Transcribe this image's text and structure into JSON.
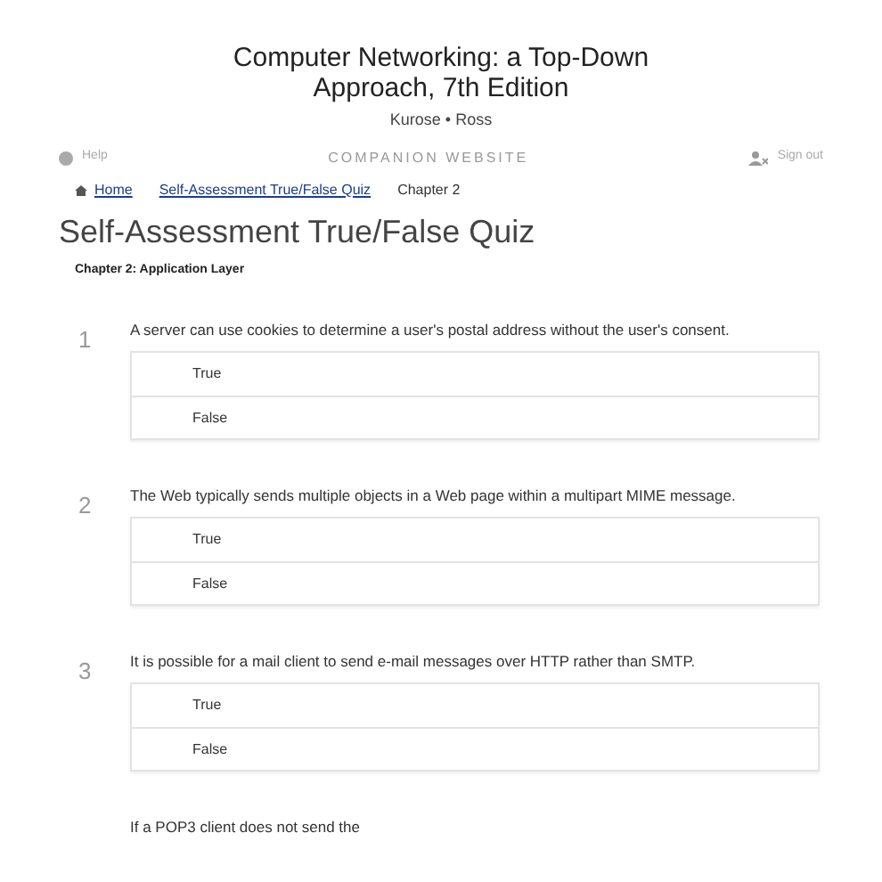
{
  "header": {
    "title": "Computer Networking: a Top-Down Approach, 7th Edition",
    "authors": "Kurose • Ross"
  },
  "nav": {
    "help": "Help",
    "site": "COMPANION WEBSITE",
    "sign_out": "Sign out"
  },
  "breadcrumb": [
    {
      "label": "Home",
      "kind": "link"
    },
    {
      "label": "Self-Assessment True/False Quiz",
      "kind": "link"
    },
    {
      "label": "Chapter 2",
      "kind": "current"
    }
  ],
  "heading": "Self-Assessment True/False Quiz",
  "subheading": "Chapter 2: Application Layer",
  "questions": [
    {
      "number": "1",
      "text": "A server can use cookies to determine a user's postal address without the user's consent.",
      "options": [
        "True",
        "False"
      ]
    },
    {
      "number": "2",
      "text": "The Web typically sends multiple objects in a Web page within a multipart MIME message.",
      "options": [
        "True",
        "False"
      ]
    },
    {
      "number": "3",
      "text": "It is possible for a mail client to send e-mail messages over HTTP rather than SMTP.",
      "options": [
        "True",
        "False"
      ]
    },
    {
      "text": "If a POP3 client does not send the"
    }
  ]
}
